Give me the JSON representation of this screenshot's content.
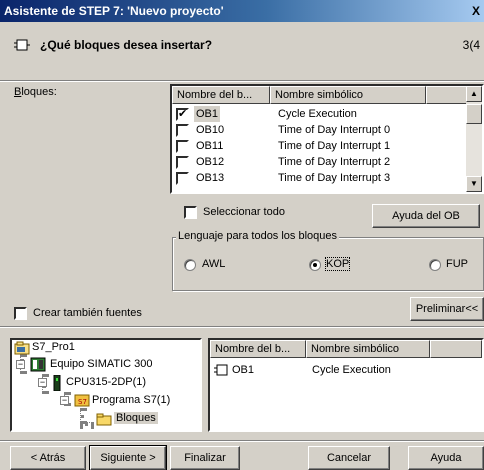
{
  "window": {
    "title": "Asistente de STEP 7: 'Nuevo proyecto'",
    "close_glyph": "X"
  },
  "header": {
    "question": "¿Qué bloques desea insertar?",
    "step": "3(4"
  },
  "blocks": {
    "label": "Bloques:",
    "columns": [
      "Nombre del b...",
      "Nombre simbólico"
    ],
    "rows": [
      {
        "name": "OB1",
        "symbol": "Cycle Execution",
        "checked": true
      },
      {
        "name": "OB10",
        "symbol": "Time of Day Interrupt 0",
        "checked": false
      },
      {
        "name": "OB11",
        "symbol": "Time of Day Interrupt 1",
        "checked": false
      },
      {
        "name": "OB12",
        "symbol": "Time of Day Interrupt 2",
        "checked": false
      },
      {
        "name": "OB13",
        "symbol": "Time of Day Interrupt 3",
        "checked": false
      }
    ],
    "select_all": "Seleccionar todo",
    "help_ob": "Ayuda del OB"
  },
  "language": {
    "legend": "Lenguaje para todos los bloques",
    "options": [
      {
        "label": "AWL",
        "selected": false
      },
      {
        "label": "KOP",
        "selected": true
      },
      {
        "label": "FUP",
        "selected": false
      }
    ]
  },
  "sources": {
    "label": "Crear también fuentes"
  },
  "preview_button": "Preliminar<<",
  "tree": {
    "items": [
      "S7_Pro1",
      "Equipo SIMATIC 300",
      "CPU315-2DP(1)",
      "Programa S7(1)",
      "Bloques"
    ]
  },
  "preview_table": {
    "columns": [
      "Nombre del b...",
      "Nombre simbólico"
    ],
    "rows": [
      {
        "name": "OB1",
        "symbol": "Cycle Execution"
      }
    ]
  },
  "footer": {
    "back": "< Atrás",
    "next": "Siguiente >",
    "finish": "Finalizar",
    "cancel": "Cancelar",
    "help": "Ayuda"
  }
}
